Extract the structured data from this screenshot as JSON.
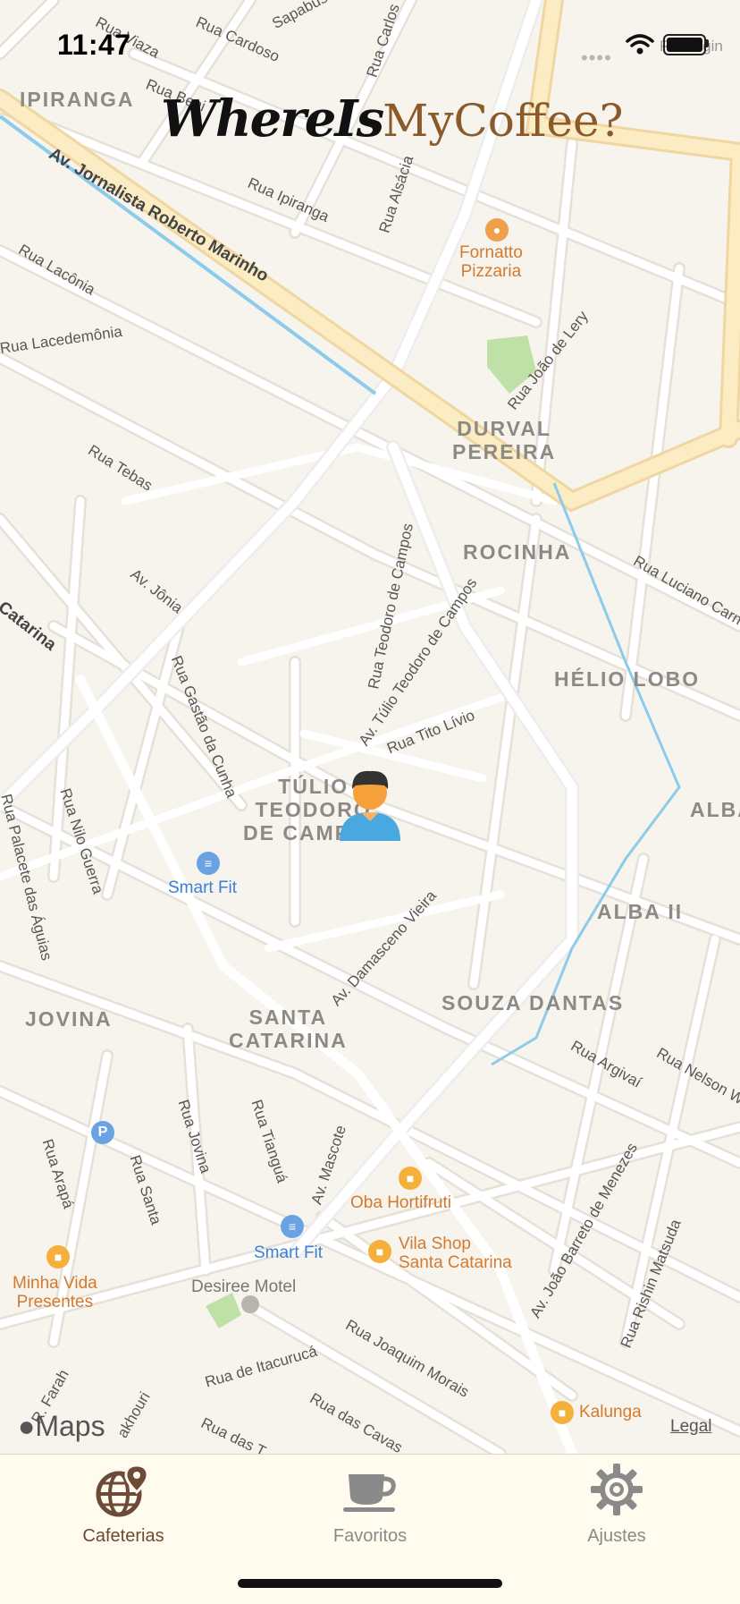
{
  "status_bar": {
    "time": "11:47",
    "carrier": "••••"
  },
  "app_title": {
    "part1": "WhereIs",
    "part2": "MyCoffee?",
    "part2_color": "#8b5a2b"
  },
  "map": {
    "neighborhoods": {
      "ipiranga": "IPIRANGA",
      "durval": "DURVAL\nPEREIRA",
      "rocinha": "ROCINHA",
      "helio": "HÉLIO LOBO",
      "alba": "ALBA",
      "alba2": "ALBA II",
      "tulio": "TÚLIO\nTEODORO\nDE CAMPOS",
      "souza": "SOUZA DANTAS",
      "santa": "SANTA\nCATARINA",
      "jovina": "JOVINA"
    },
    "streets": {
      "viaza": "Rua Viaza",
      "cardoso": "Rua Cardoso",
      "sapabussu": "Sapabussu",
      "carlos": "Rua Carlos",
      "borgin": "R. Borgin",
      "beni": "Rua Beni",
      "jornalista": "Av. Jornalista Roberto Marinho",
      "ipiranga_rua": "Rua Ipiranga",
      "alsacia": "Rua Alsácia",
      "laconia": "Rua Lacônia",
      "lacedemonia": "Rua Lacedemônia",
      "joao_lery": "Rua João de Lery",
      "tebas": "Rua Tebas",
      "jonia": "Av. Jônia",
      "catarina": "Catarina",
      "luciano": "Rua Luciano Carn",
      "teodoro_campos": "Rua Teodoro de Campos",
      "gastao": "Rua Gastão da Cunha",
      "tulio_av": "Av. Túlio Teodoro de Campos",
      "tito": "Rua Tito Lívio",
      "palacete": "Rua Palacete das Águias",
      "nilo": "Rua Nilo Guerra",
      "damasceno": "Av. Damasceno Vieira",
      "argivai": "Rua Argivaí",
      "nelson": "Rua Nelson W",
      "arapa": "Rua Arapá",
      "santa_rua": "Rua Santa",
      "jovina_rua": "Rua Jovina",
      "tiangua": "Rua Tianguá",
      "mascote": "Av. Mascote",
      "barreto": "Av. João Barreto de Menezes",
      "rishin": "Rua Rishin Matsuda",
      "itacuruca": "Rua de Itacurucá",
      "joaquim": "Rua Joaquim Morais",
      "cavas": "Rua das Cavas",
      "dast": "Rua das T",
      "farah": "R. Farah",
      "kakhouri": "akhouri"
    },
    "pois": {
      "fornatto": "Fornatto\nPizzaria",
      "smartfit1": "Smart Fit",
      "smartfit2": "Smart Fit",
      "oba": "Oba Hortifruti",
      "vila": "Vila Shop\nSanta Catarina",
      "minha": "Minha Vida\nPresentes",
      "desiree": "Desiree Motel",
      "kalunga": "Kalunga",
      "parking": "P"
    },
    "brand": "Maps",
    "legal": "Legal",
    "user_marker_icon": "user-avatar-icon"
  },
  "tabbar": {
    "tabs": [
      {
        "label": "Cafeterias",
        "icon": "globe-pin-icon",
        "active": true,
        "color": "#6b4a36"
      },
      {
        "label": "Favoritos",
        "icon": "coffee-cup-icon",
        "active": false,
        "color": "#8a8a8a"
      },
      {
        "label": "Ajustes",
        "icon": "gear-icon",
        "active": false,
        "color": "#8a8a8a"
      }
    ]
  },
  "colors": {
    "map_bg": "#f7f4ee",
    "road": "#ffffff",
    "highway": "#fbe6b8",
    "water": "#8ccbea",
    "park": "#bfe0a6",
    "tabbar_bg": "#fffbee"
  }
}
